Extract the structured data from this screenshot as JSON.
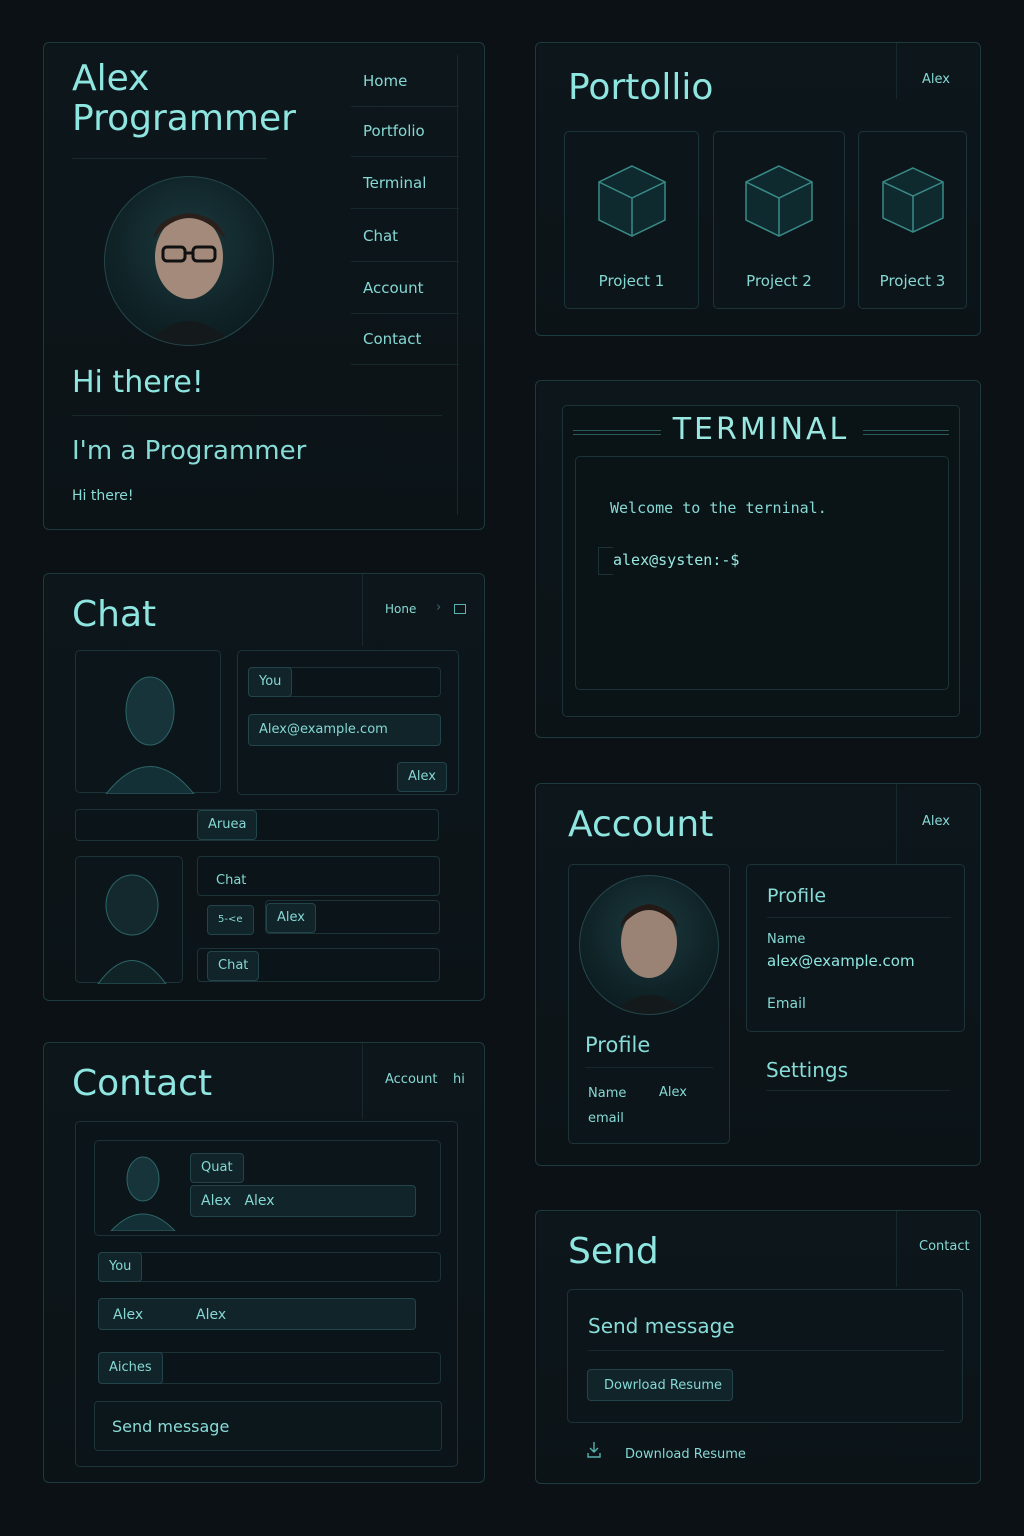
{
  "profile": {
    "name_line1": "Alex",
    "name_line2": "Programmer",
    "greeting": "Hi there!",
    "tagline": "I'm a Programmer",
    "note": "Hi there!",
    "nav": [
      "Home",
      "Portfolio",
      "Terminal",
      "Chat",
      "Account",
      "Contact"
    ]
  },
  "portfolio": {
    "title": "Portollio",
    "user": "Alex",
    "projects": [
      "Project 1",
      "Project 2",
      "Project 3"
    ]
  },
  "terminal": {
    "title": "TERMINAL",
    "welcome": "Welcome to the terninal.",
    "prompt": "alex@systen:-$"
  },
  "chat": {
    "title": "Chat",
    "breadcrumb": "Hone",
    "you_chip": "You",
    "email": "Alex@example.com",
    "alex_chip": "Alex",
    "aruea": "Aruea",
    "chat_label1": "Chat",
    "small_label": "5-<e",
    "alex_chip2": "Alex",
    "chat_label2": "Chat"
  },
  "account": {
    "title": "Account",
    "user": "Alex",
    "profile_heading": "Profile",
    "name_label": "Name",
    "email_value": "alex@example.com",
    "email_label": "Email",
    "settings": "Settings",
    "left_profile": "Profile",
    "left_name_label": "Name",
    "left_name_value": "Alex",
    "left_email_label": "email"
  },
  "contact": {
    "title": "Contact",
    "breadcrumb": "Account",
    "breadcrumb2": "hi",
    "quat": "Quat",
    "alex_pair": "Alex   Alex",
    "you": "You",
    "alex1": "Alex",
    "alex2": "Alex",
    "aiches": "Aiches",
    "send_message": "Send message"
  },
  "send": {
    "title": "Send",
    "breadcrumb": "Contact",
    "send_message": "Send message",
    "download_button": "Dowrload Resume",
    "download_link": "Download Resume"
  }
}
